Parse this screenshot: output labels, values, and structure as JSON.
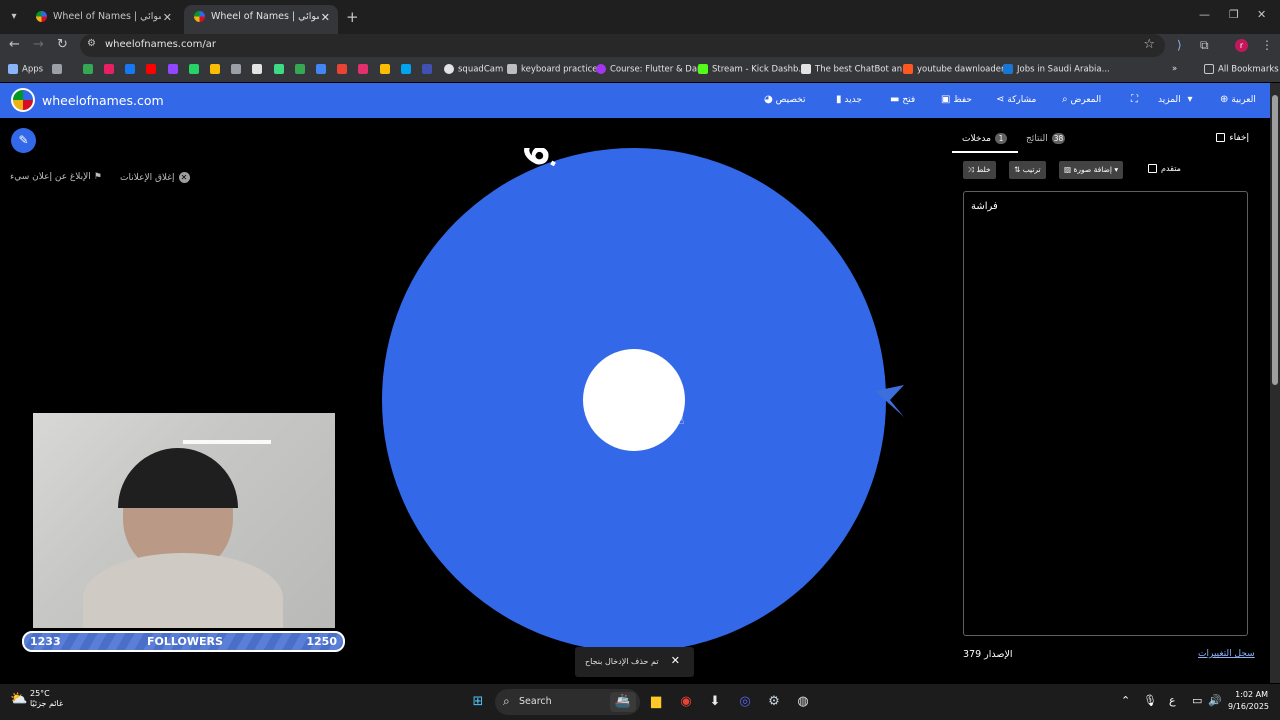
{
  "browser": {
    "tabs": [
      {
        "title": "Wheel of Names | سم العشوائي",
        "active": false
      },
      {
        "title": "Wheel of Names | سم العشوائي",
        "active": true
      }
    ],
    "url": "wheelofnames.com/ar",
    "bookmarks": [
      {
        "label": "Apps",
        "icon": "apps-icon"
      },
      {
        "label": "squadCam",
        "icon": "squadcam-icon"
      },
      {
        "label": "keyboard practice",
        "icon": "keyboard-icon"
      },
      {
        "label": "Course: Flutter & Dart",
        "icon": "course-icon"
      },
      {
        "label": "Stream - Kick Dashb...",
        "icon": "kick-icon"
      },
      {
        "label": "The best ChatBot an...",
        "icon": "chatbot-icon"
      },
      {
        "label": "youtube dawnloader",
        "icon": "downloader-icon"
      },
      {
        "label": "Jobs in Saudi Arabia...",
        "icon": "jobs-icon"
      }
    ],
    "all_bookmarks": "All Bookmarks"
  },
  "site": {
    "title": "wheelofnames.com",
    "nav": {
      "customize": "تخصيص",
      "new": "جديد",
      "open": "فتح",
      "save": "حفظ",
      "share": "مشاركة",
      "gallery": "المعرض",
      "more": "المزيد",
      "language": "العربية"
    }
  },
  "ads": {
    "close_ads": "إغلاق الإعلانات",
    "report_ad": "الإبلاغ عن إعلان سيء"
  },
  "wheel": {
    "slice_text": "فراشة",
    "color": "#3369e8"
  },
  "overlay": {
    "followers_label": "FOLLOWERS",
    "followers_current": "1233",
    "followers_goal": "1250"
  },
  "toast": {
    "message": "تم حذف الإدخال بنجاح"
  },
  "panel": {
    "entries_tab": "مدخلات",
    "entries_count": "1",
    "results_tab": "النتائج",
    "results_count": "38",
    "hide_label": "إخفاء",
    "shuffle": "خلط",
    "sort": "ترتيب",
    "add_image": "إضافة صورة",
    "advanced": "متقدم",
    "entries": [
      "فراشة"
    ],
    "version": "الإصدار 379",
    "changelog": "سجل التغييرات"
  },
  "taskbar": {
    "temperature": "25°C",
    "weather_label": "غائم جزئيًا",
    "search": "Search",
    "time": "1:02 AM",
    "date": "9/16/2025",
    "lang": "ع"
  }
}
